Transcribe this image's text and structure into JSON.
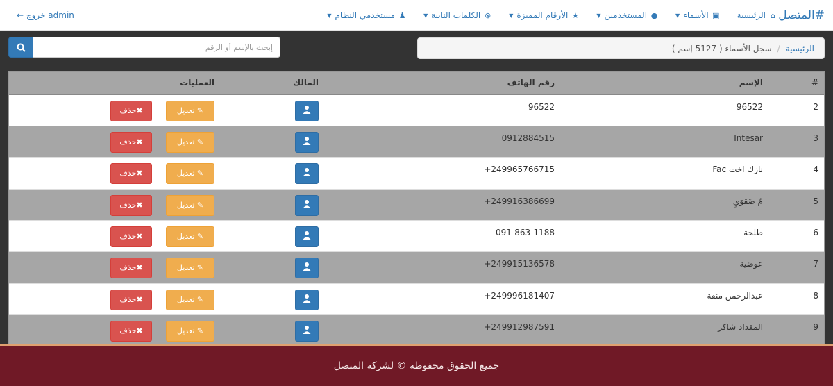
{
  "navbar": {
    "brand": "#المتصل",
    "items": [
      {
        "label": "الرئيسية",
        "icon": "home-icon",
        "glyph": "⌂",
        "dropdown": false
      },
      {
        "label": "الأسماء",
        "icon": "contact-book-icon",
        "glyph": "▣",
        "dropdown": true
      },
      {
        "label": "المستخدمين",
        "icon": "user-icon",
        "glyph": "●",
        "dropdown": true
      },
      {
        "label": "الأرقام المميزة",
        "icon": "star-icon",
        "glyph": "★",
        "dropdown": true
      },
      {
        "label": "الكلمات النابية",
        "icon": "times-circle-icon",
        "glyph": "⊗",
        "dropdown": true
      },
      {
        "label": "مستخدمي النظام",
        "icon": "users-icon",
        "glyph": "♟",
        "dropdown": true
      }
    ],
    "logout": "خروج admin",
    "logout_icon": "←"
  },
  "breadcrumb": {
    "home": "الرئيسية",
    "separator": "/",
    "current": "سجل الأسماء ( 5127 إسم )"
  },
  "search": {
    "placeholder": "إبحث بالإسم أو الرقم",
    "button_icon": "search-icon"
  },
  "table": {
    "headers": {
      "index": "#",
      "name": "الإسم",
      "phone": "رقم الهاتف",
      "owner": "المالك",
      "ops": "العمليات"
    },
    "edit_label": "تعديل",
    "delete_label": "حذف",
    "rows": [
      {
        "index": "2",
        "name": "96522",
        "phone": "96522"
      },
      {
        "index": "3",
        "name": "Intesar",
        "phone": "0912884515"
      },
      {
        "index": "4",
        "name": "نازك اخت Fac",
        "phone": "+249965766715"
      },
      {
        "index": "5",
        "name": "مٌ ضَقوَيِ",
        "phone": "+249916386699"
      },
      {
        "index": "6",
        "name": "طلحة",
        "phone": "091-863-1188"
      },
      {
        "index": "7",
        "name": "عوضية",
        "phone": "+249915136578"
      },
      {
        "index": "8",
        "name": "عبدالرحمن منقة",
        "phone": "+249996181407"
      },
      {
        "index": "9",
        "name": "المقداد شاكر",
        "phone": "+249912987591"
      }
    ]
  },
  "footer": {
    "text": "جميع الحقوق محفوظة © لشركة المتصل"
  },
  "colors": {
    "primary": "#337ab7",
    "warning": "#f0ad4e",
    "danger": "#d9534f",
    "footer": "#701926",
    "row_alt": "#a6a6a6"
  }
}
